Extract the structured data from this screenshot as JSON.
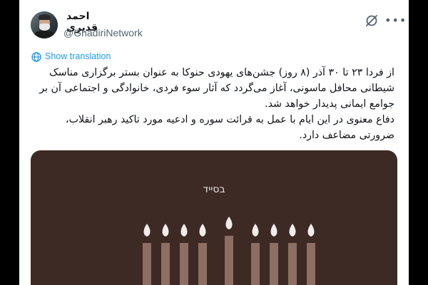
{
  "author": {
    "name": "احمد قدیری",
    "handle": "@GhadiriNetwork"
  },
  "icons": {
    "grok": "grok-icon",
    "more": "more-options-icon",
    "translate": "globe-translate-icon"
  },
  "translation": {
    "label": "Show translation"
  },
  "tweet": {
    "paragraph1": "از فردا ۲۳ تا ۳۰ آذر (۸ روز) جشن‌های یهودی حنوکا به عنوان بستر برگزاری مناسک شیطانی محافل ماسونی، آغاز می‌گردد که آثار سوء فردی، خانوادگی و اجتماعی آن بر جوامع ایمانی پدیدار خواهد شد.",
    "paragraph2": "دفاع معنوی در این ایام با عمل به قرائت سوره و ادعیه مورد تاکید رهبر انقلاب، ضرورتی مضاعف دارد."
  },
  "media": {
    "caption": "בסייד",
    "background": "#3d2a25",
    "candle_color": "#8d6e62",
    "flame_color": "#f2ede8"
  },
  "colors": {
    "link": "#1d9bf0",
    "text": "#0f1419",
    "muted": "#536471"
  }
}
